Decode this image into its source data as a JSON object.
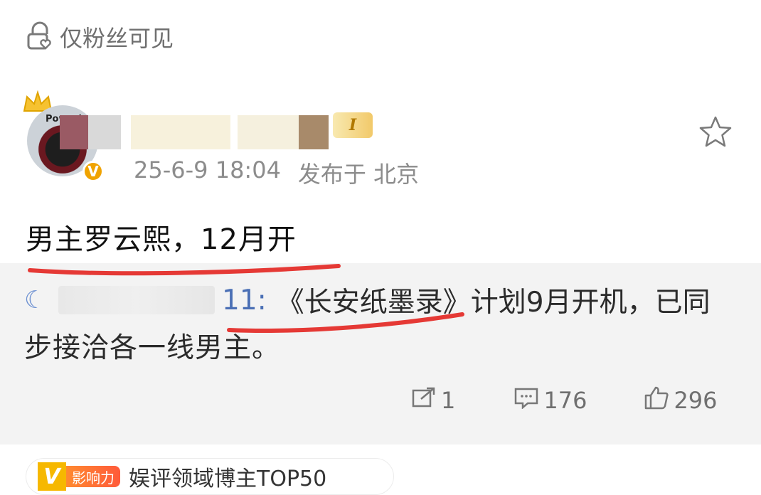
{
  "visibility": {
    "label": "仅粉丝可见"
  },
  "post": {
    "avatar_text": "Power!",
    "verified_mark": "V",
    "level_badge": "I",
    "timestamp": "25-6-9 18:04",
    "location": "发布于 北京",
    "text": "男主罗云熙，12月开"
  },
  "repost": {
    "author_suffix": "11:",
    "text_line1": "《长安纸墨录》计划9月开机，已同",
    "text_line2": "步接洽各一线男主。"
  },
  "actions": {
    "share_count": "1",
    "comment_count": "176",
    "like_count": "296"
  },
  "tag": {
    "badge_v": "V",
    "badge_label": "影响力",
    "text": "娱评领域博主TOP50"
  },
  "colors": {
    "underline": "#e53935",
    "badge_gold": "#f0a300",
    "repost_bg": "#f3f3f3",
    "muted": "#8c8c8c"
  }
}
